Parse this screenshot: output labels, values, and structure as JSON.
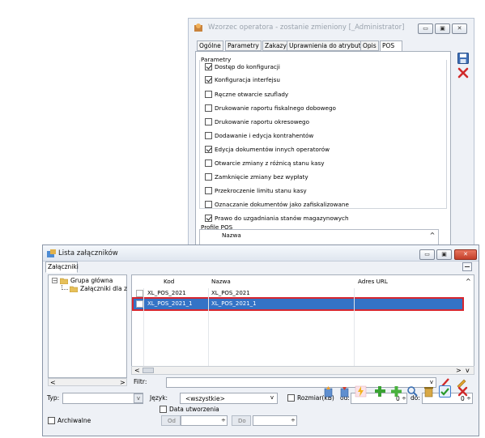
{
  "back_window": {
    "title": "Wzorzec operatora - zostanie zmieniony [_Administrator]",
    "tabs": [
      "Ogólne",
      "Parametry",
      "Zakazy",
      "Uprawnienia do atrybutów",
      "Opis",
      "POS"
    ],
    "active_tab": "POS",
    "group_label": "Parametry",
    "params": [
      {
        "label": "Dostęp do konfiguracji",
        "checked": true
      },
      {
        "label": "Konfiguracja interfejsu",
        "checked": true
      },
      {
        "label": "Ręczne otwarcie szuflady",
        "checked": false
      },
      {
        "label": "Drukowanie raportu fiskalnego dobowego",
        "checked": false
      },
      {
        "label": "Drukowanie raportu okresowego",
        "checked": false
      },
      {
        "label": "Dodawanie i edycja kontrahentów",
        "checked": false
      },
      {
        "label": "Edycja dokumentów innych operatorów",
        "checked": true
      },
      {
        "label": "Otwarcie zmiany z różnicą stanu kasy",
        "checked": false
      },
      {
        "label": "Zamknięcie zmiany bez wypłaty",
        "checked": false
      },
      {
        "label": "Przekroczenie limitu stanu kasy",
        "checked": false
      },
      {
        "label": "Oznaczanie dokumentów jako zafiskalizowane",
        "checked": false
      },
      {
        "label": "Prawo do uzgadniania stanów magazynowych",
        "checked": true
      }
    ],
    "profile_label": "Profile POS",
    "profile_column": "Nazwa"
  },
  "front_window": {
    "title": "Lista załączników",
    "tab": "Załączniki",
    "tree": {
      "root": "Grupa główna",
      "child": "Załączniki dla z"
    },
    "columns": {
      "kod": "Kod",
      "nazwa": "Nazwa",
      "adres": "Adres URL"
    },
    "rows": [
      {
        "kod": "XL_POS_2021",
        "nazwa": "XL_POS_2021",
        "adres": "",
        "selected": false
      },
      {
        "kod": "XL_POS_2021_1",
        "nazwa": "XL_POS_2021_1",
        "adres": "",
        "selected": true
      }
    ],
    "filter_label": "Filtr:",
    "type_label": "Typ:",
    "lang_label": "Język:",
    "lang_value": "<wszystkie>",
    "size_label": "Rozmiar(kB)",
    "od_label": "od:",
    "od_value": "0",
    "do_label": "do:",
    "do_value": "0",
    "date_label": "Data utworzenia",
    "date_from_label": "Od",
    "date_to_label": "Do",
    "archive_label": "Archiwalne"
  }
}
